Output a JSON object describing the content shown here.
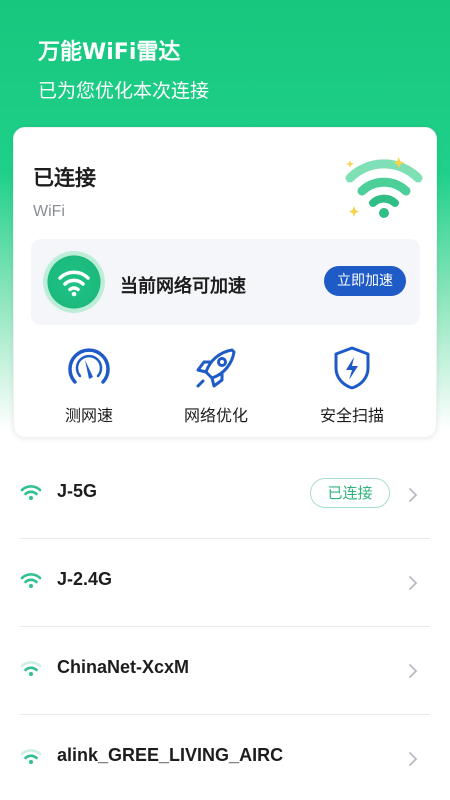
{
  "header": {
    "title": "万能WiFi雷达",
    "subtitle": "已为您优化本次连接"
  },
  "card": {
    "status": "已连接",
    "ssid": "WiFi",
    "boost": {
      "text": "当前网络可加速",
      "button_label": "立即加速"
    },
    "tools": [
      {
        "label": "测网速",
        "icon": "speedometer-icon"
      },
      {
        "label": "网络优化",
        "icon": "rocket-icon"
      },
      {
        "label": "安全扫描",
        "icon": "shield-bolt-icon"
      }
    ]
  },
  "networks": [
    {
      "name": "J-5G",
      "badge": "已连接",
      "icon": "wifi-strong-icon"
    },
    {
      "name": "J-2.4G",
      "icon": "wifi-strong-icon"
    },
    {
      "name": "ChinaNet-XcxM",
      "icon": "wifi-medium-icon"
    },
    {
      "name": "alink_GREE_LIVING_AIRC",
      "icon": "wifi-medium-icon"
    }
  ],
  "colors": {
    "brand_green": "#1fd08a",
    "button_blue": "#1e5bc6",
    "icon_blue": "#1e5bc6",
    "wifi_teal": "#2fc08c"
  }
}
